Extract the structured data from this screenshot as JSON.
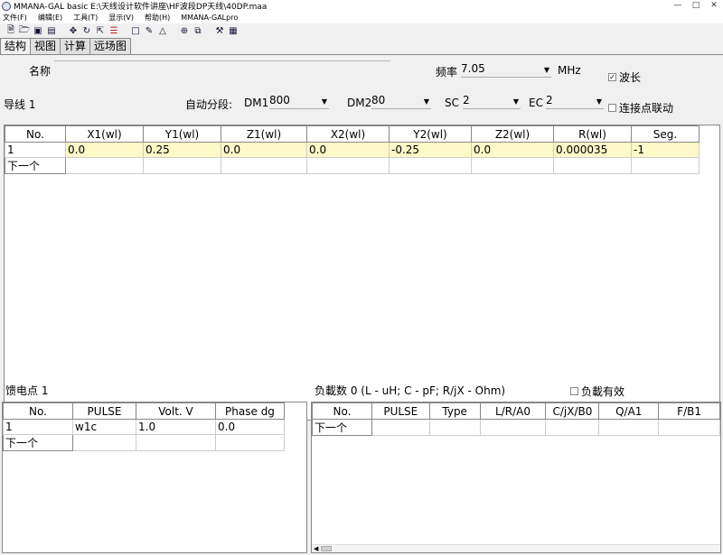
{
  "window": {
    "title": "MMANA-GAL basic  E:\\天线设计软件讲座\\HF波段DP天线\\40DP.maa"
  },
  "menu": [
    "文件(F)",
    "编辑(E)",
    "工具(T)",
    "显示(V)",
    "帮助(H)",
    "MMANA-GALpro"
  ],
  "toolbar_icons": [
    "new-file-icon",
    "open-folder-icon",
    "save-icon",
    "print-icon",
    "move-icon",
    "rotate-icon",
    "stretch-icon",
    "settings-bars-icon",
    "new-doc-icon",
    "edit-icon",
    "triangle-icon",
    "target-icon",
    "copy-icon",
    "tools-icon",
    "calculator-icon"
  ],
  "tabs": [
    "结构",
    "视图",
    "计算",
    "远场图"
  ],
  "header": {
    "name_label": "名称",
    "freq_label": "频率",
    "freq_value": "7.05",
    "freq_unit": "MHz",
    "wavelength_label": "波长",
    "wire_label": "导线 1",
    "auto_seg_label": "自动分段:",
    "dm1_label": "DM1",
    "dm1_value": "800",
    "dm2_label": "DM2",
    "dm2_value": "80",
    "sc_label": "SC",
    "sc_value": "2",
    "ec_label": "EC",
    "ec_value": "2",
    "link_label": "连接点联动"
  },
  "wires": {
    "columns": [
      "No.",
      "X1(wl)",
      "Y1(wl)",
      "Z1(wl)",
      "X2(wl)",
      "Y2(wl)",
      "Z2(wl)",
      "R(wl)",
      "Seg."
    ],
    "rows": [
      [
        "1",
        "0.0",
        "0.25",
        "0.0",
        "0.0",
        "-0.25",
        "0.0",
        "0.000035",
        "-1"
      ]
    ],
    "next_label": "下一个"
  },
  "sources": {
    "label": "馈电点 1",
    "columns": [
      "No.",
      "PULSE",
      "Volt. V",
      "Phase dg"
    ],
    "rows": [
      [
        "1",
        "w1c",
        "1.0",
        "0.0"
      ]
    ],
    "next_label": "下一个"
  },
  "loads": {
    "label": "负載数 0 (L - uH; C - pF; R/jX - Ohm)",
    "enable_label": "负載有效",
    "columns": [
      "No.",
      "PULSE",
      "Type",
      "L/R/A0",
      "C/jX/B0",
      "Q/A1",
      "F/B1"
    ],
    "next_label": "下一个"
  }
}
